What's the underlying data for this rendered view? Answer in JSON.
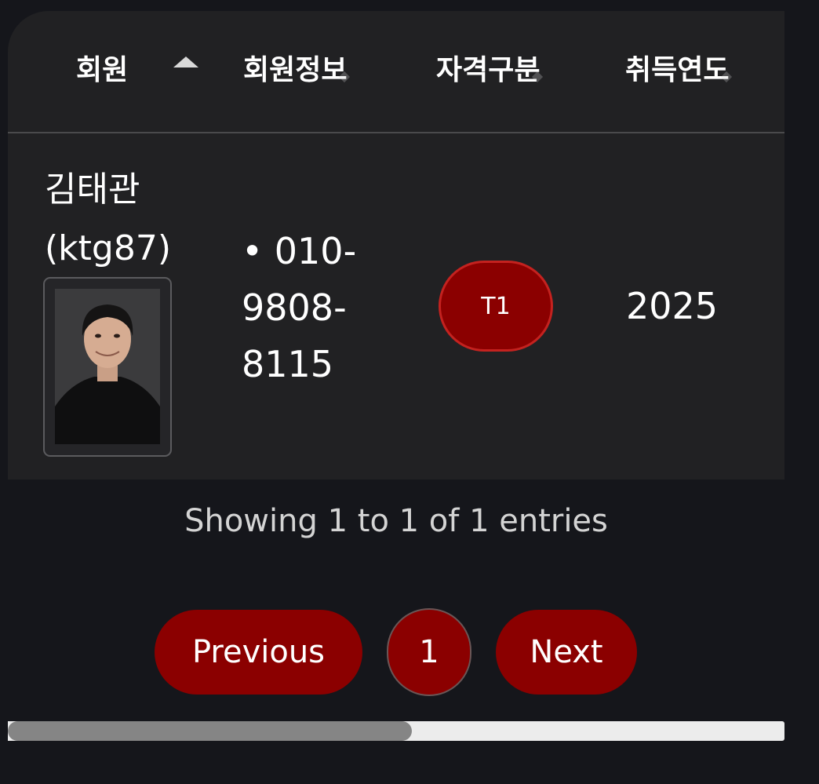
{
  "table": {
    "headers": {
      "member": "회원",
      "member_info": "회원정보",
      "qualification": "자격구분",
      "year": "취득연도"
    },
    "row": {
      "name": "김태관",
      "user_id": "(ktg87)",
      "phone_bullet": "•",
      "phone_parts": [
        "010-",
        "9808-",
        "8115"
      ],
      "qualification_badge": "T1",
      "year": "2025"
    }
  },
  "info_text": "Showing 1 to 1 of 1 entries",
  "pagination": {
    "previous_label": "Previous",
    "page_label": "1",
    "next_label": "Next"
  },
  "colors": {
    "page_bg": "#15161b",
    "card_bg": "#212123",
    "accent": "#8b0000",
    "accent_border": "#c4221f",
    "text": "#ffffff",
    "muted_text": "#d4d4d4"
  },
  "icons": {
    "sort_active": "sort-ascending-icon",
    "sort_inactive": "sort-unsorted-icon",
    "member_photo": "member-photo"
  }
}
